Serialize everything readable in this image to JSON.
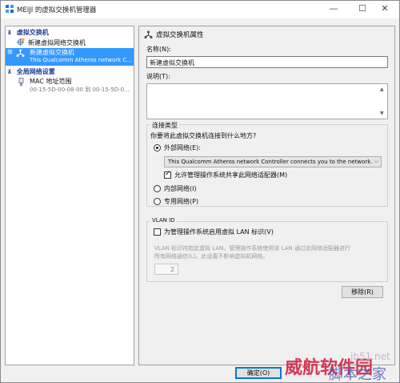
{
  "window": {
    "title": "MEIJI 的虚拟交换机管理器",
    "min_glyph": "—",
    "max_glyph": "☐",
    "close_glyph": "✕"
  },
  "tree": {
    "virtual_switches": {
      "header": "虚拟交换机",
      "new_item": "新建虚拟网络交换机",
      "selected": {
        "name": "新建虚拟交换机",
        "detail": "This Qualcomm Atheros network C..."
      }
    },
    "global": {
      "header": "全局网络设置",
      "mac": {
        "name": "MAC 地址范围",
        "detail": "00-15-5D-00-08-00 到 00-15-5D-0..."
      }
    },
    "collapse_glyph": "⊼",
    "expand_glyph": "⊞"
  },
  "props": {
    "header": "虚拟交换机属性",
    "name_label": "名称(N):",
    "name_value": "新建虚拟交换机",
    "notes_label": "说明(T):",
    "notes_value": "",
    "conn_type": {
      "title": "连接类型",
      "question": "你要将此虚拟交换机连接到什么地方?",
      "external": "外部网络(E):",
      "adapter": "This Qualcomm Atheros network Controller connects you to the network.",
      "share": "允许管理操作系统共享此网络适配器(M)",
      "internal": "内部网络(I)",
      "private": "专用网络(P)",
      "selected": "external",
      "share_checked": true
    },
    "vlan": {
      "title": "VLAN ID",
      "enable": "为管理操作系统启用虚拟 LAN 标识(V)",
      "desc_line1": "VLAN 标识符指定虚拟 LAN，管理操作系统使用该 LAN 通过此网络适配器进行",
      "desc_line2": "所有网络通信(L)。此设置不影响虚拟机网络。",
      "value": "2",
      "checked": false
    },
    "remove_button": "移除(R)"
  },
  "footer": {
    "ok_button": "确定(O)"
  },
  "watermark": {
    "red": "威航软件园",
    "site": "jb51.net",
    "blue": "脚本之家"
  },
  "colors": {
    "selection": "#3399ff",
    "section_header": "#1c3d96",
    "default_button_border": "#0078d7"
  }
}
